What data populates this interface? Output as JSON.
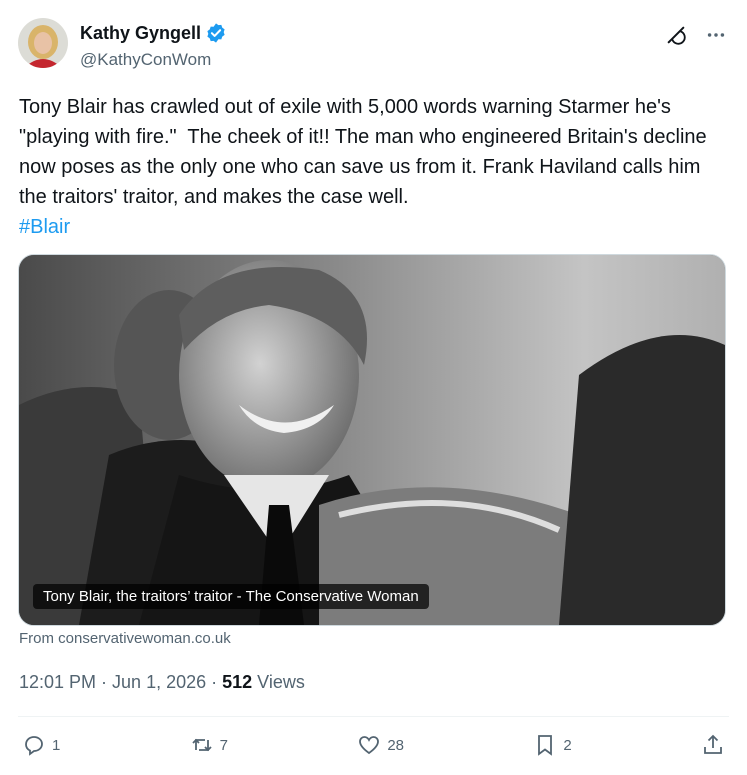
{
  "author": {
    "name": "Kathy Gyngell",
    "handle": "@KathyConWom",
    "verified_color": "#1d9bf0"
  },
  "tweet": {
    "text": "Tony Blair has crawled out of exile with 5,000 words warning Starmer he's \"playing with fire.\"  The cheek of it!! The man who engineered Britain's decline now poses as the only one who can save us from it. Frank Haviland calls him the traitors' traitor, and makes the case well.",
    "hashtag": "#Blair"
  },
  "card": {
    "title": "Tony Blair, the traitors’ traitor - The Conservative Woman",
    "source": "From conservativewoman.co.uk"
  },
  "meta": {
    "time": "12:01 PM",
    "separator": " · ",
    "date": "Jun 1, 2026",
    "views_count": "512",
    "views_label": " Views"
  },
  "actions": {
    "replies": "1",
    "reposts": "7",
    "likes": "28",
    "bookmarks": "2"
  },
  "icons": {
    "top_right": [
      "grok-icon",
      "more-icon"
    ],
    "actions": [
      "reply-icon",
      "repost-icon",
      "like-icon",
      "bookmark-icon",
      "share-icon"
    ]
  }
}
